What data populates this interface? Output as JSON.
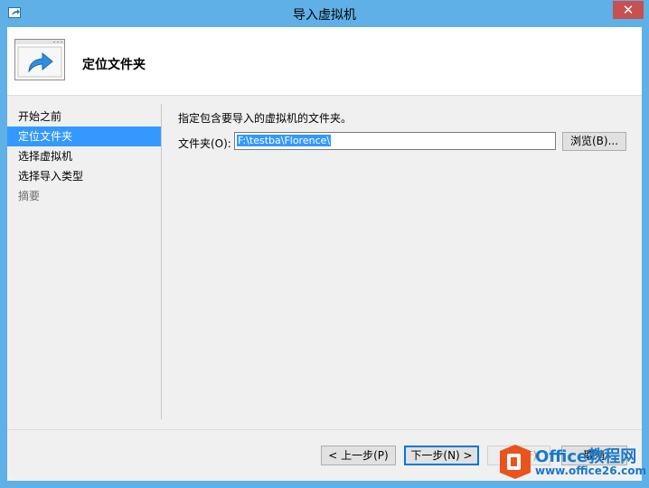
{
  "window": {
    "title": "导入虚拟机",
    "close_glyph": "✕",
    "app_icon": "import-arrow-icon",
    "accent_color": "#5fb0e6"
  },
  "header": {
    "title": "定位文件夹",
    "icon": "window-arrow-icon"
  },
  "nav": {
    "items": [
      {
        "label": "开始之前",
        "state": "normal"
      },
      {
        "label": "定位文件夹",
        "state": "active"
      },
      {
        "label": "选择虚拟机",
        "state": "normal"
      },
      {
        "label": "选择导入类型",
        "state": "normal"
      },
      {
        "label": "摘要",
        "state": "disabled"
      }
    ]
  },
  "main": {
    "instruction": "指定包含要导入的虚拟机的文件夹。",
    "folder_label": "文件夹(O):",
    "folder_value": "F:\\testba\\Florence\\",
    "browse_label": "浏览(B)..."
  },
  "footer": {
    "prev_label": "< 上一步(P)",
    "next_label": "下一步(N) >",
    "finish_label": "完成(F)",
    "cancel_label": "取消"
  },
  "watermark": {
    "line1": "Office教程网",
    "line2": "www.office26.com",
    "icon": "office-logo-icon"
  }
}
